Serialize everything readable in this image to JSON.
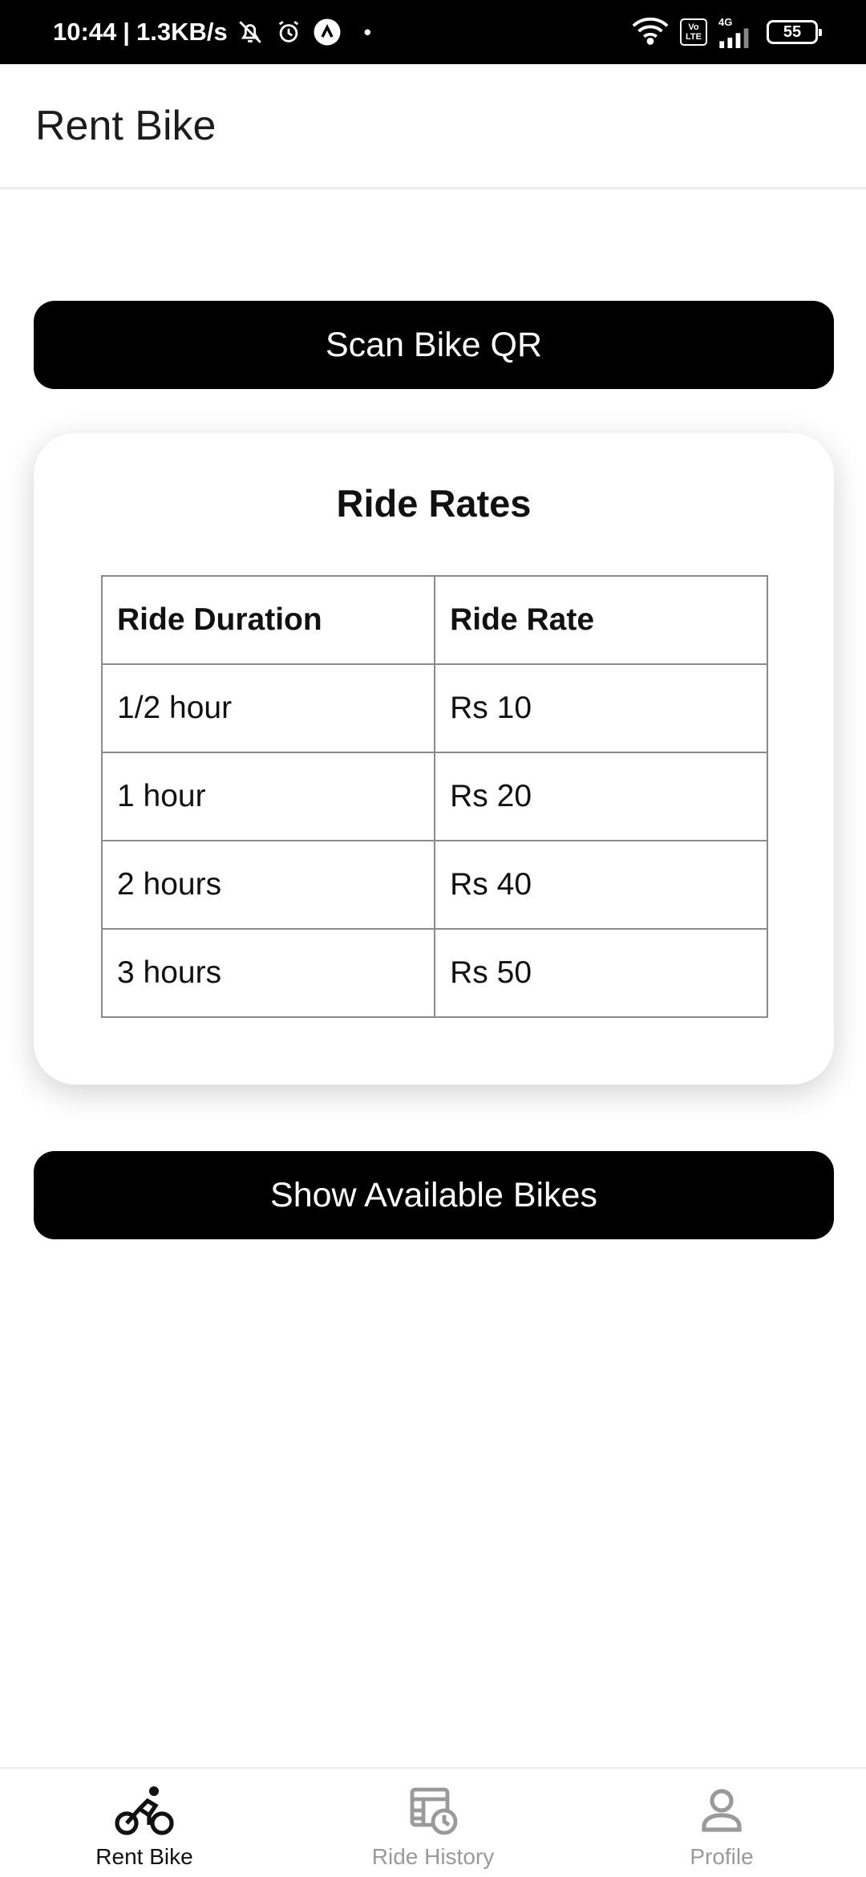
{
  "status_bar": {
    "time": "10:44",
    "separator": "|",
    "speed": "1.3KB/s",
    "dot": "•",
    "volte_top": "Vo",
    "volte_bottom": "LTE",
    "network": "4G",
    "battery": "55",
    "icons": [
      "muted-bell-icon",
      "alarm-icon",
      "app-notification-icon",
      "wifi-icon",
      "volte-icon",
      "signal-icon",
      "battery-icon"
    ]
  },
  "app_bar": {
    "title": "Rent Bike"
  },
  "scan_button": {
    "label": "Scan Bike QR"
  },
  "rates_card": {
    "title": "Ride Rates",
    "headers": [
      "Ride Duration",
      "Ride Rate"
    ],
    "rows": [
      {
        "duration": "1/2 hour",
        "rate": "Rs 10"
      },
      {
        "duration": "1 hour",
        "rate": "Rs 20"
      },
      {
        "duration": "2 hours",
        "rate": "Rs 40"
      },
      {
        "duration": "3 hours",
        "rate": "Rs 50"
      }
    ]
  },
  "show_button": {
    "label": "Show Available Bikes"
  },
  "bottom_nav": {
    "items": [
      {
        "label": "Rent Bike",
        "icon": "bicycle-icon",
        "active": true
      },
      {
        "label": "Ride History",
        "icon": "history-icon",
        "active": false
      },
      {
        "label": "Profile",
        "icon": "person-icon",
        "active": false
      }
    ]
  },
  "colors": {
    "primary": "#000000",
    "active_nav": "#111111",
    "inactive_nav": "#9a9a9a"
  }
}
